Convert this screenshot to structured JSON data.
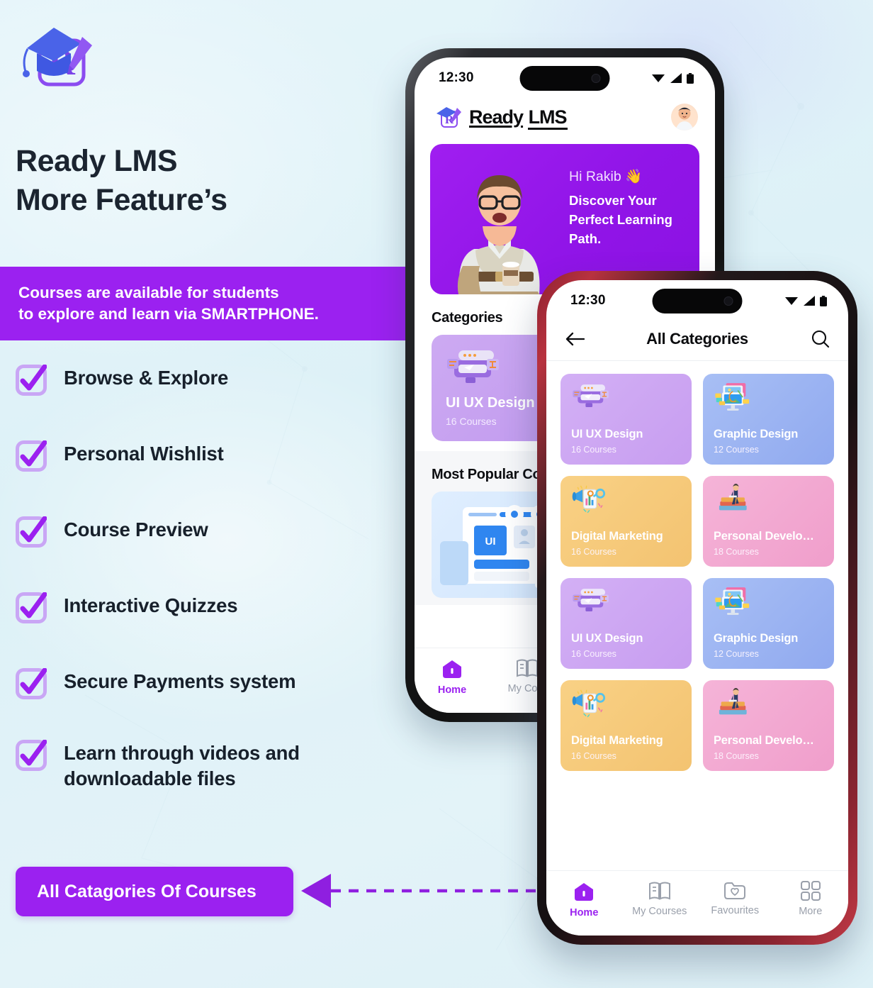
{
  "promo": {
    "logo_icon": "graduation-cap-book-pencil-logo",
    "headline_line1": "Ready LMS",
    "headline_line2": "More Feature’s",
    "strip_line1": "Courses are available for students",
    "strip_line2": "to explore and learn via SMARTPHONE.",
    "features": [
      {
        "label": "Browse & Explore"
      },
      {
        "label": "Personal Wishlist"
      },
      {
        "label": "Course Preview"
      },
      {
        "label": "Interactive Quizzes"
      },
      {
        "label": "Secure Payments system"
      },
      {
        "label": "Learn through videos and",
        "label2": "downloadable files"
      }
    ],
    "cta_label": "All Catagories Of Courses",
    "accent_purple": "#9b21f0",
    "background_color": "#e1f3f8"
  },
  "phone_home": {
    "status": {
      "time": "12:30",
      "wifi_icon": "wifi-icon",
      "signal_icon": "signal-icon",
      "battery_icon": "battery-icon"
    },
    "header": {
      "brand_first": "Ready",
      "brand_second": "LMS",
      "logo_icon": "ready-lms-logo-icon",
      "avatar_icon": "user-avatar"
    },
    "hero": {
      "greeting": "Hi Rakib 👋",
      "tagline_l1": "Discover Your",
      "tagline_l2": "Perfect Learning",
      "tagline_l3": "Path.",
      "illustration_icon": "student-with-coffee-3d"
    },
    "categories_title": "Categories",
    "category_card": {
      "name": "UI UX Design",
      "count": "16 Courses",
      "icon": "ui-ux-design-icon"
    },
    "popular_title": "Most Popular Co",
    "popular_card": {
      "icon": "ui-course-thumbnail"
    },
    "tabs": [
      {
        "label": "Home",
        "icon": "home-icon",
        "active": true
      },
      {
        "label": "My Cour",
        "icon": "book-icon",
        "active": false
      }
    ]
  },
  "phone_categories": {
    "status": {
      "time": "12:30",
      "wifi_icon": "wifi-icon",
      "signal_icon": "signal-icon",
      "battery_icon": "battery-icon"
    },
    "header": {
      "title": "All Categories",
      "back_icon": "back-arrow-icon",
      "search_icon": "search-icon"
    },
    "cards": [
      {
        "name": "UI UX Design",
        "count": "16 Courses",
        "theme": "cc-purple",
        "icon": "ui-ux-design-icon"
      },
      {
        "name": "Graphic Design",
        "count": "12 Courses",
        "theme": "cc-blue",
        "icon": "graphic-design-icon"
      },
      {
        "name": "Digital Marketing",
        "count": "16 Courses",
        "theme": "cc-amber",
        "icon": "digital-marketing-icon"
      },
      {
        "name": "Personal Develo…",
        "count": "18 Courses",
        "theme": "cc-pink",
        "icon": "personal-development-icon"
      },
      {
        "name": "UI UX Design",
        "count": "16 Courses",
        "theme": "cc-purple",
        "icon": "ui-ux-design-icon"
      },
      {
        "name": "Graphic Design",
        "count": "12 Courses",
        "theme": "cc-blue",
        "icon": "graphic-design-icon"
      },
      {
        "name": "Digital Marketing",
        "count": "16 Courses",
        "theme": "cc-amber",
        "icon": "digital-marketing-icon"
      },
      {
        "name": "Personal Develo…",
        "count": "18 Courses",
        "theme": "cc-pink",
        "icon": "personal-development-icon"
      }
    ],
    "tabs": [
      {
        "label": "Home",
        "icon": "home-icon",
        "active": true
      },
      {
        "label": "My Courses",
        "icon": "book-icon",
        "active": false
      },
      {
        "label": "Favourites",
        "icon": "folder-heart-icon",
        "active": false
      },
      {
        "label": "More",
        "icon": "grid-icon",
        "active": false
      }
    ]
  }
}
